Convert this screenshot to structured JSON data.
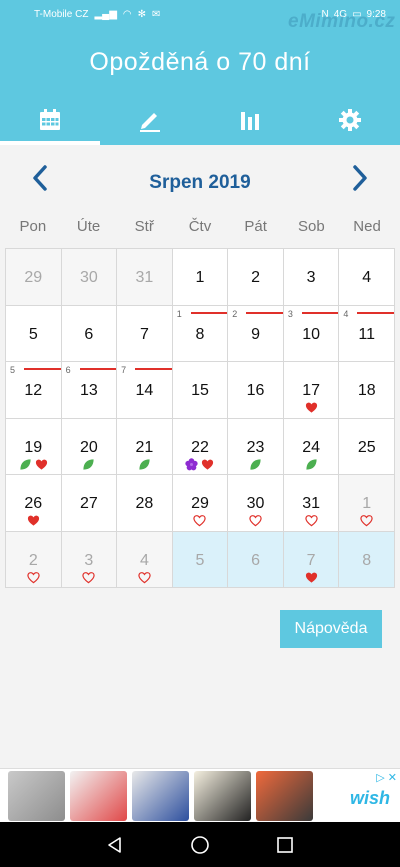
{
  "status_bar": {
    "carrier": "T-Mobile CZ",
    "time": "9:28",
    "network": "4G"
  },
  "watermark": "eMimino.cz",
  "header": {
    "title": "Opožděná o 70 dní"
  },
  "tabs": [
    {
      "name": "calendar",
      "icon": "calendar-icon",
      "active": true
    },
    {
      "name": "notes",
      "icon": "pencil-icon",
      "active": false
    },
    {
      "name": "stats",
      "icon": "bar-chart-icon",
      "active": false
    },
    {
      "name": "settings",
      "icon": "gear-icon",
      "active": false
    }
  ],
  "calendar": {
    "month_title": "Srpen 2019",
    "weekdays": [
      "Pon",
      "Úte",
      "Stř",
      "Čtv",
      "Pát",
      "Sob",
      "Ned"
    ],
    "days": [
      {
        "day": "29",
        "type": "other",
        "icons": []
      },
      {
        "day": "30",
        "type": "other",
        "icons": []
      },
      {
        "day": "31",
        "type": "other",
        "icons": []
      },
      {
        "day": "1",
        "type": "current",
        "icons": []
      },
      {
        "day": "2",
        "type": "current",
        "icons": []
      },
      {
        "day": "3",
        "type": "current",
        "icons": []
      },
      {
        "day": "4",
        "type": "current",
        "icons": []
      },
      {
        "day": "5",
        "type": "current",
        "icons": []
      },
      {
        "day": "6",
        "type": "current",
        "icons": []
      },
      {
        "day": "7",
        "type": "current",
        "icons": []
      },
      {
        "day": "8",
        "type": "current",
        "cycle": "1",
        "period": true,
        "icons": []
      },
      {
        "day": "9",
        "type": "current",
        "cycle": "2",
        "period": true,
        "icons": []
      },
      {
        "day": "10",
        "type": "current",
        "cycle": "3",
        "period": true,
        "icons": []
      },
      {
        "day": "11",
        "type": "current",
        "cycle": "4",
        "period": true,
        "icons": []
      },
      {
        "day": "12",
        "type": "current",
        "cycle": "5",
        "period": true,
        "icons": []
      },
      {
        "day": "13",
        "type": "current",
        "cycle": "6",
        "period": true,
        "icons": []
      },
      {
        "day": "14",
        "type": "current",
        "cycle": "7",
        "period": true,
        "icons": []
      },
      {
        "day": "15",
        "type": "current",
        "icons": []
      },
      {
        "day": "16",
        "type": "current",
        "icons": []
      },
      {
        "day": "17",
        "type": "current",
        "icons": [
          "heart-filled"
        ]
      },
      {
        "day": "18",
        "type": "current",
        "icons": []
      },
      {
        "day": "19",
        "type": "current",
        "icons": [
          "leaf",
          "heart-filled"
        ]
      },
      {
        "day": "20",
        "type": "current",
        "icons": [
          "leaf"
        ]
      },
      {
        "day": "21",
        "type": "current",
        "icons": [
          "leaf"
        ]
      },
      {
        "day": "22",
        "type": "current",
        "icons": [
          "flower",
          "heart-filled"
        ]
      },
      {
        "day": "23",
        "type": "current",
        "icons": [
          "leaf"
        ]
      },
      {
        "day": "24",
        "type": "current",
        "icons": [
          "leaf"
        ]
      },
      {
        "day": "25",
        "type": "current",
        "icons": []
      },
      {
        "day": "26",
        "type": "current",
        "icons": [
          "heart-filled"
        ]
      },
      {
        "day": "27",
        "type": "current",
        "icons": []
      },
      {
        "day": "28",
        "type": "current",
        "icons": []
      },
      {
        "day": "29",
        "type": "current",
        "icons": [
          "heart-outline"
        ]
      },
      {
        "day": "30",
        "type": "current",
        "icons": [
          "heart-outline"
        ]
      },
      {
        "day": "31",
        "type": "current",
        "icons": [
          "heart-outline"
        ]
      },
      {
        "day": "1",
        "type": "other",
        "icons": [
          "heart-outline"
        ]
      },
      {
        "day": "2",
        "type": "other",
        "icons": [
          "heart-outline"
        ]
      },
      {
        "day": "3",
        "type": "other",
        "icons": [
          "heart-outline"
        ]
      },
      {
        "day": "4",
        "type": "other",
        "icons": [
          "heart-outline"
        ]
      },
      {
        "day": "5",
        "type": "pred",
        "icons": []
      },
      {
        "day": "6",
        "type": "pred",
        "icons": []
      },
      {
        "day": "7",
        "type": "pred",
        "icons": [
          "heart-filled"
        ]
      },
      {
        "day": "8",
        "type": "pred",
        "icons": []
      }
    ]
  },
  "help_button": {
    "label": "Nápověda"
  },
  "ad_banner": {
    "logo": "wish",
    "close": "▷ ✕"
  },
  "colors": {
    "primary": "#5ec8e0",
    "month_title": "#1f5f9a",
    "period_line": "#e0302a",
    "heart": "#e0302a",
    "leaf": "#4caf50",
    "flower": "#8e2bd1"
  }
}
